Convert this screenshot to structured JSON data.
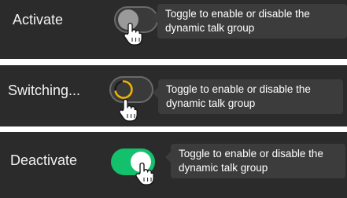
{
  "rows": [
    {
      "label": "Activate",
      "state": "off",
      "tooltip": {
        "line1": "Toggle to enable or disable the",
        "line2": "dynamic talk group"
      }
    },
    {
      "label": "Switching...",
      "state": "switching",
      "tooltip": {
        "line1": "Toggle to enable or disable the",
        "line2": "dynamic talk group"
      }
    },
    {
      "label": "Deactivate",
      "state": "on",
      "tooltip": {
        "line1": "Toggle to enable or disable the",
        "line2": "dynamic talk group"
      }
    }
  ],
  "colors": {
    "panel_bg": "#2b2b2b",
    "tooltip_bg": "#3c3c3c",
    "toggle_on": "#13c06c",
    "spinner": "#f0b400",
    "separator": "#ffffff"
  },
  "icons": {
    "cursor": "hand-pointer-icon",
    "spinner": "loading-spinner-icon"
  }
}
